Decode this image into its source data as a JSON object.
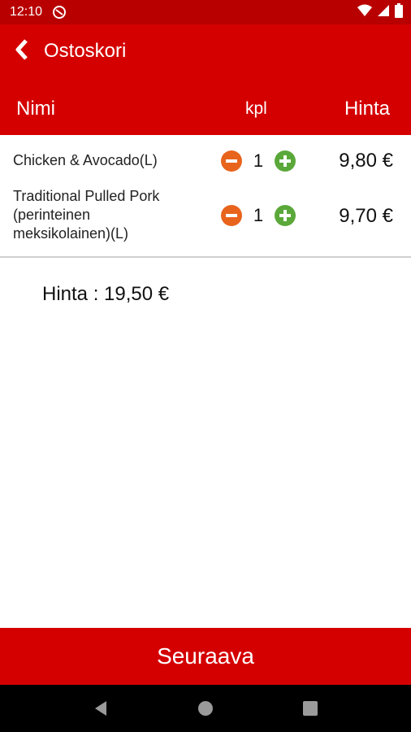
{
  "status_bar": {
    "time": "12:10",
    "icons": [
      "sync-off-icon",
      "wifi-icon",
      "signal-icon",
      "battery-icon"
    ]
  },
  "app_bar": {
    "title": "Ostoskori",
    "back_icon": "chevron-left-icon"
  },
  "columns": {
    "name": "Nimi",
    "qty": "kpl",
    "price": "Hinta"
  },
  "items": [
    {
      "name": "Chicken & Avocado(L)",
      "qty": "1",
      "price": "9,80 €"
    },
    {
      "name": "Traditional Pulled Pork (perinteinen meksikolainen)(L)",
      "qty": "1",
      "price": "9,70 €"
    }
  ],
  "total": "Hinta : 19,50 €",
  "next_button": "Seuraava",
  "nav_bar": {
    "icons": [
      "back-triangle-icon",
      "home-circle-icon",
      "recents-square-icon"
    ]
  },
  "colors": {
    "primary": "#d40000",
    "status_bar": "#b80000",
    "minus": "#e8641d",
    "plus": "#5aa83a"
  }
}
